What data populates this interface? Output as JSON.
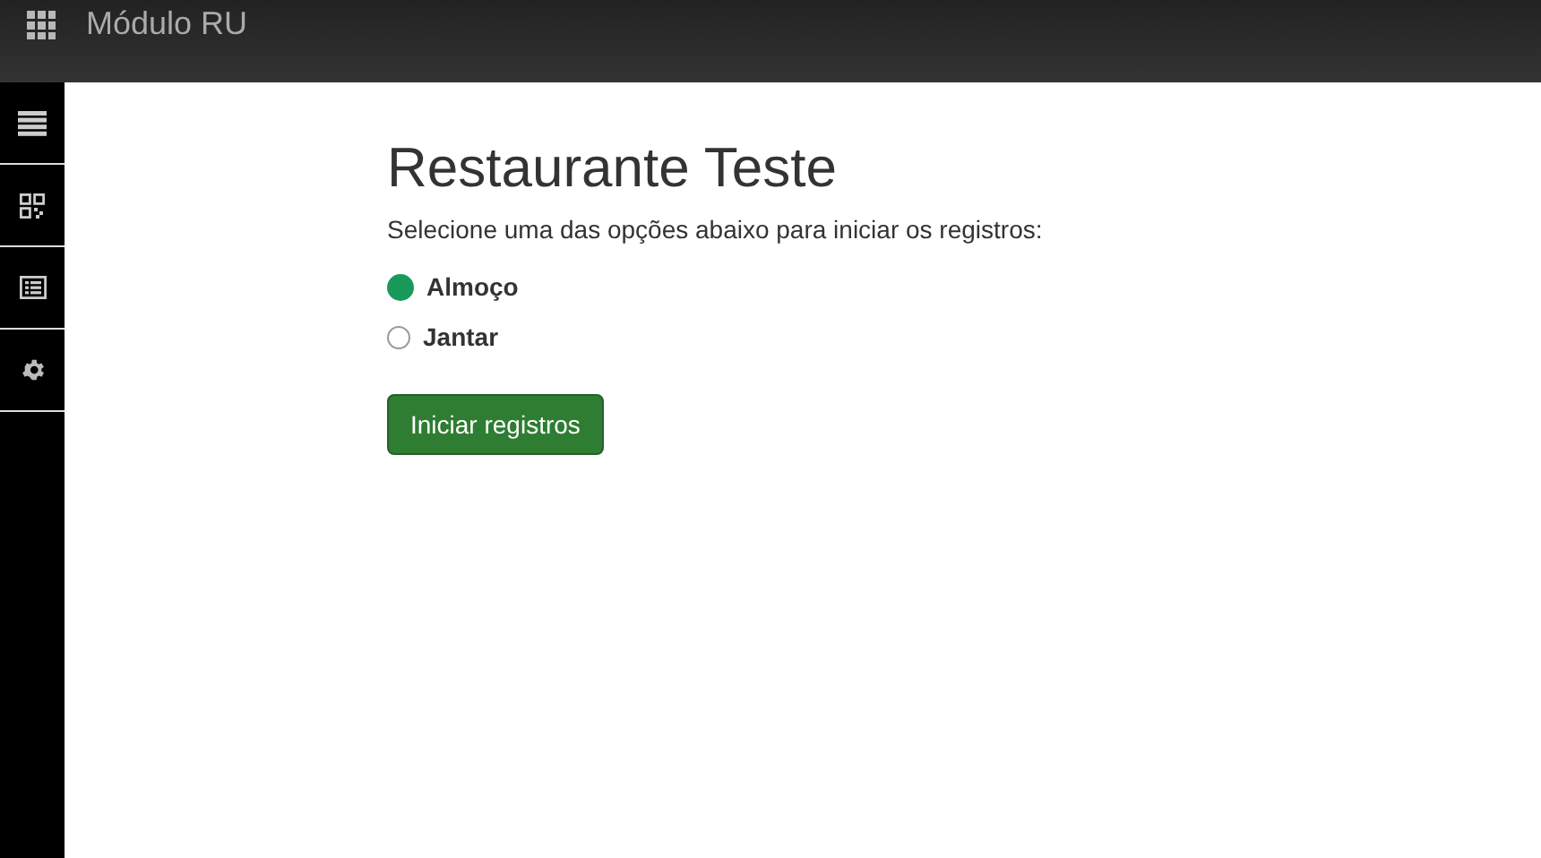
{
  "header": {
    "title": "Módulo RU"
  },
  "page": {
    "title": "Restaurante Teste",
    "instruction": "Selecione uma das opções abaixo para iniciar os registros:",
    "options": [
      {
        "label": "Almoço",
        "selected": true
      },
      {
        "label": "Jantar",
        "selected": false
      }
    ],
    "button": "Iniciar registros"
  }
}
